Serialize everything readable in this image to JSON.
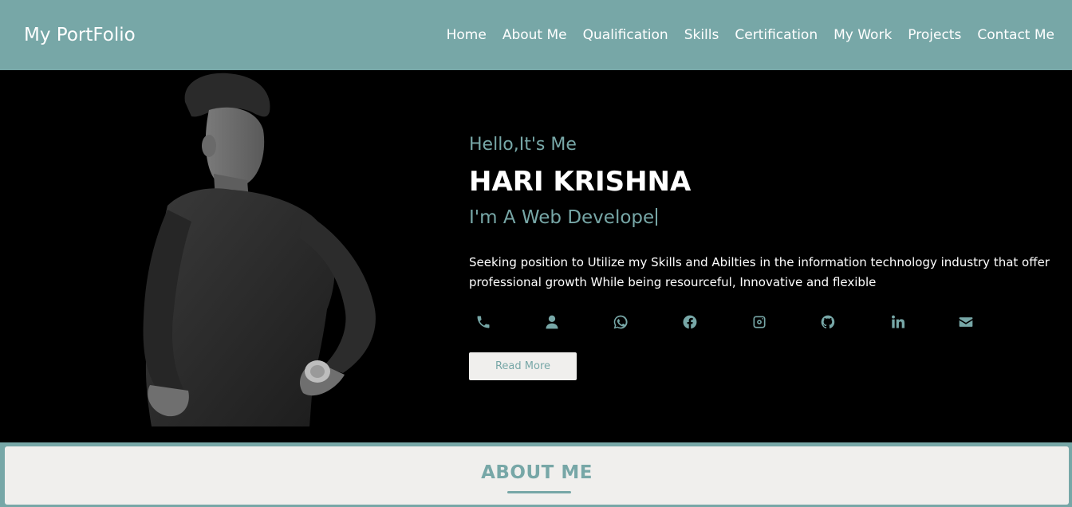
{
  "brand": "My PortFolio",
  "nav": [
    "Home",
    "About Me",
    "Qualification",
    "Skills",
    "Certification",
    "My Work",
    "Projects",
    "Contact Me"
  ],
  "hero": {
    "greeting": "Hello,It's Me",
    "name": "HARI KRISHNA",
    "role": "I'm A Web Develope",
    "description": "Seeking position to Utilize my Skills and Abilties in the information technology industry that offer professional growth While being resourceful, Innovative and flexible",
    "read_more": "Read More"
  },
  "socials": [
    "phone-icon",
    "user-icon",
    "whatsapp-icon",
    "facebook-icon",
    "instagram-icon",
    "github-icon",
    "linkedin-icon",
    "envelope-icon"
  ],
  "about": {
    "title": "ABOUT ME"
  },
  "colors": {
    "accent": "#77a7a7",
    "background": "#000000",
    "card": "#f0efed"
  }
}
